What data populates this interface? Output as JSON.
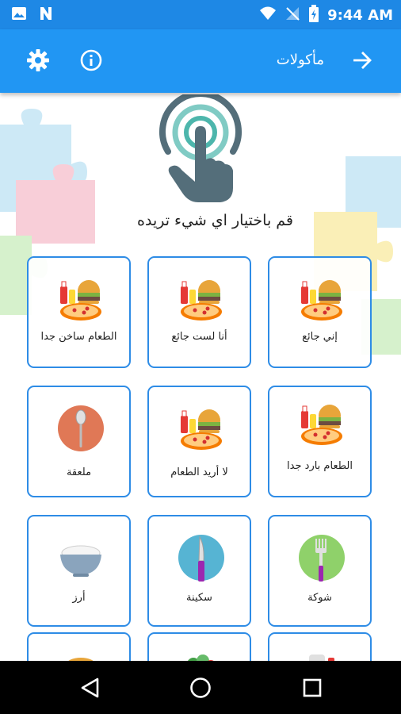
{
  "status_bar": {
    "time": "9:44 AM"
  },
  "app_bar": {
    "title": "مأكولات"
  },
  "instruction": "قم باختيار اي شيء تريده",
  "cards": [
    {
      "label": "إني جائع",
      "icon": "food-combo-icon"
    },
    {
      "label": "أنا لست جائع",
      "icon": "food-combo-icon"
    },
    {
      "label": "الطعام ساخن جدا",
      "icon": "food-combo-icon"
    },
    {
      "label": "الطعام بارد جدا",
      "icon": "food-combo-icon"
    },
    {
      "label": "لا أريد الطعام",
      "icon": "food-combo-icon"
    },
    {
      "label": "ملعقة",
      "icon": "spoon-icon"
    },
    {
      "label": "شوكة",
      "icon": "fork-icon"
    },
    {
      "label": "سكينة",
      "icon": "knife-icon"
    },
    {
      "label": "أرز",
      "icon": "rice-bowl-icon"
    },
    {
      "label": "",
      "icon": "drinks-icon"
    },
    {
      "label": "",
      "icon": "salad-icon"
    },
    {
      "label": "",
      "icon": "bread-icon"
    }
  ],
  "colors": {
    "status_bar": "#1e88e5",
    "app_bar": "#2196f3",
    "card_border": "#2e8ce6",
    "nav_bar": "#000000"
  }
}
